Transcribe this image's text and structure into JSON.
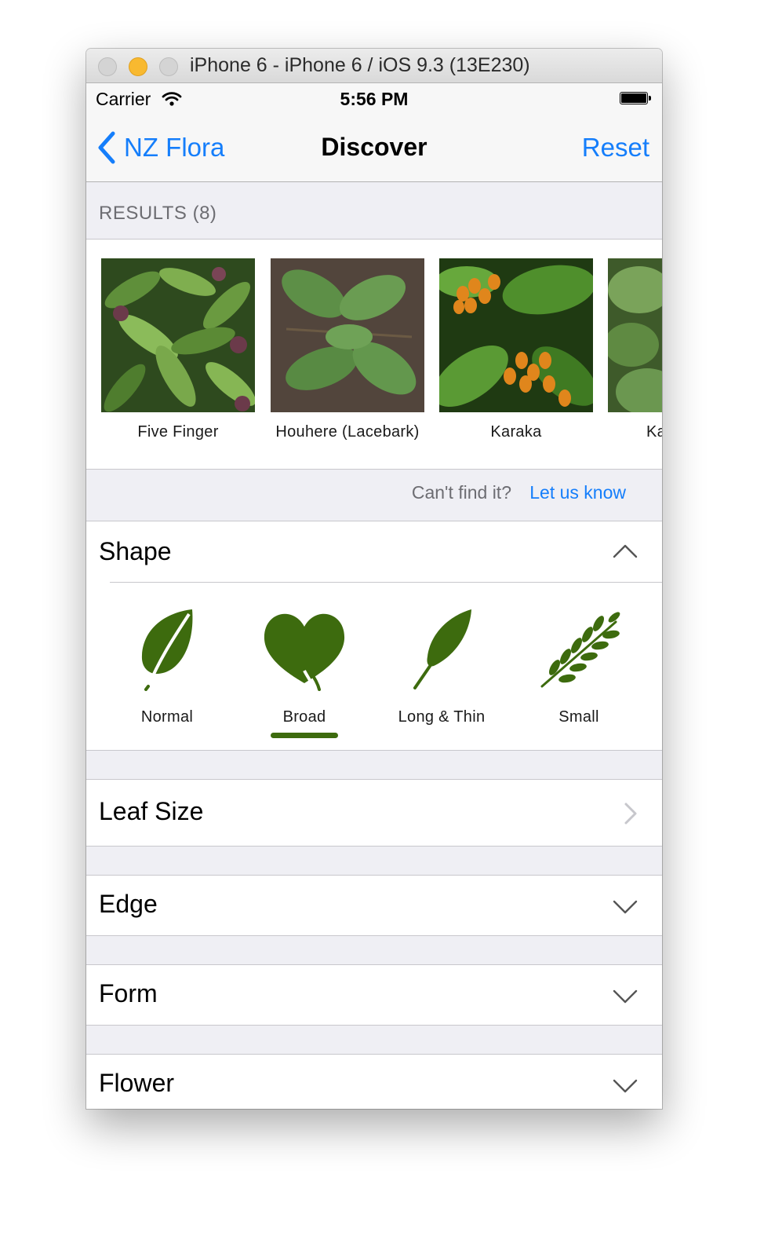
{
  "window": {
    "title": "iPhone 6 - iPhone 6 / iOS 9.3 (13E230)"
  },
  "status_bar": {
    "carrier": "Carrier",
    "time": "5:56 PM"
  },
  "nav": {
    "back_label": "NZ Flora",
    "title": "Discover",
    "reset_label": "Reset"
  },
  "results": {
    "header": "RESULTS (8)",
    "items": [
      {
        "name": "Five Finger"
      },
      {
        "name": "Houhere (Lacebark)"
      },
      {
        "name": "Karaka"
      },
      {
        "name": "Ka"
      }
    ]
  },
  "feedback": {
    "question": "Can't find it?",
    "link": "Let us know"
  },
  "filters": {
    "shape": {
      "title": "Shape",
      "options": [
        {
          "label": "Normal",
          "icon": "normal-leaf-icon"
        },
        {
          "label": "Broad",
          "icon": "broad-leaf-icon",
          "selected": true
        },
        {
          "label": "Long & Thin",
          "icon": "long-thin-leaf-icon"
        },
        {
          "label": "Small",
          "icon": "small-leaf-icon"
        }
      ]
    },
    "leaf_size": {
      "title": "Leaf Size"
    },
    "edge": {
      "title": "Edge"
    },
    "form": {
      "title": "Form"
    },
    "flower": {
      "title": "Flower"
    }
  },
  "colors": {
    "accent": "#157efb",
    "leaf_green": "#3d6b0e",
    "grouped_bg": "#efeff4"
  }
}
